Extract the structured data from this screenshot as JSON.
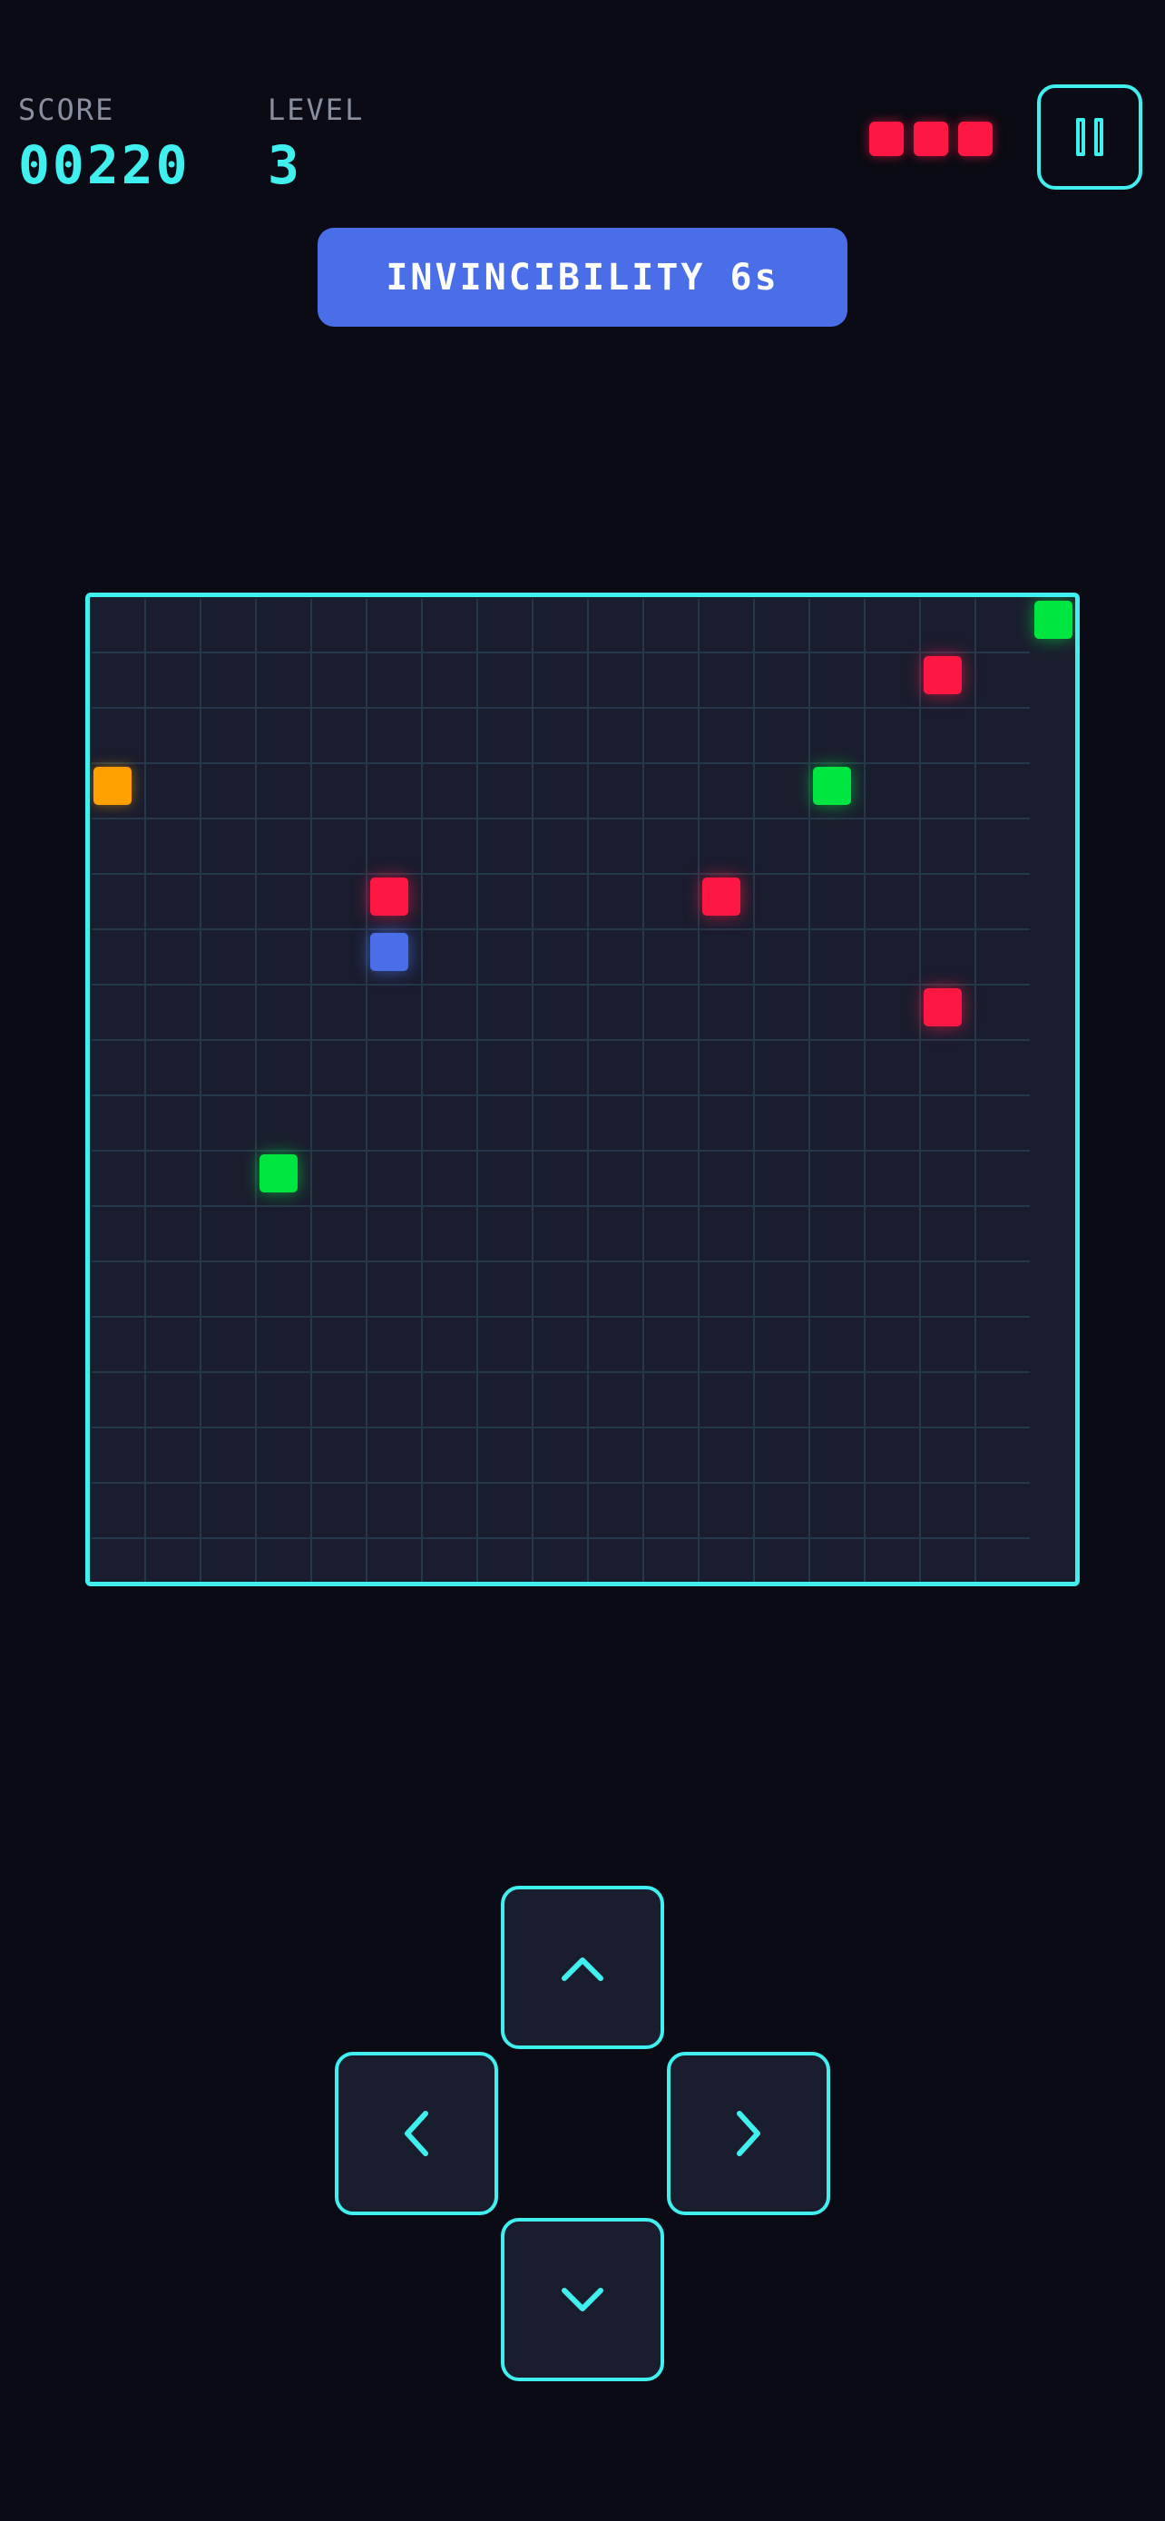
{
  "hud": {
    "score_label": "SCORE",
    "score_value": "00220",
    "level_label": "LEVEL",
    "level_value": "3",
    "lives": 3
  },
  "powerup": {
    "label": "INVINCIBILITY 6s"
  },
  "board": {
    "cols": 17,
    "rows": 18,
    "obstacles": [
      {
        "col": 15,
        "row": 1
      },
      {
        "col": 5,
        "row": 5
      },
      {
        "col": 11,
        "row": 5
      },
      {
        "col": 15,
        "row": 7
      }
    ],
    "food": [
      {
        "col": 17,
        "row": 0
      },
      {
        "col": 13,
        "row": 3
      },
      {
        "col": 3,
        "row": 10
      }
    ],
    "bonus": [
      {
        "col": 0,
        "row": 3
      }
    ],
    "snake": [
      {
        "col": 5,
        "row": 6
      }
    ]
  },
  "controls": {
    "up": "chevron-up-icon",
    "left": "chevron-left-icon",
    "right": "chevron-right-icon",
    "down": "chevron-down-icon"
  },
  "colors": {
    "accent": "#3ff0ef",
    "obstacle": "#ff1744",
    "food": "#00e640",
    "bonus": "#ffa000",
    "snake": "#4a6ee8",
    "background": "#0a0b14",
    "board": "#1a1d2e"
  }
}
